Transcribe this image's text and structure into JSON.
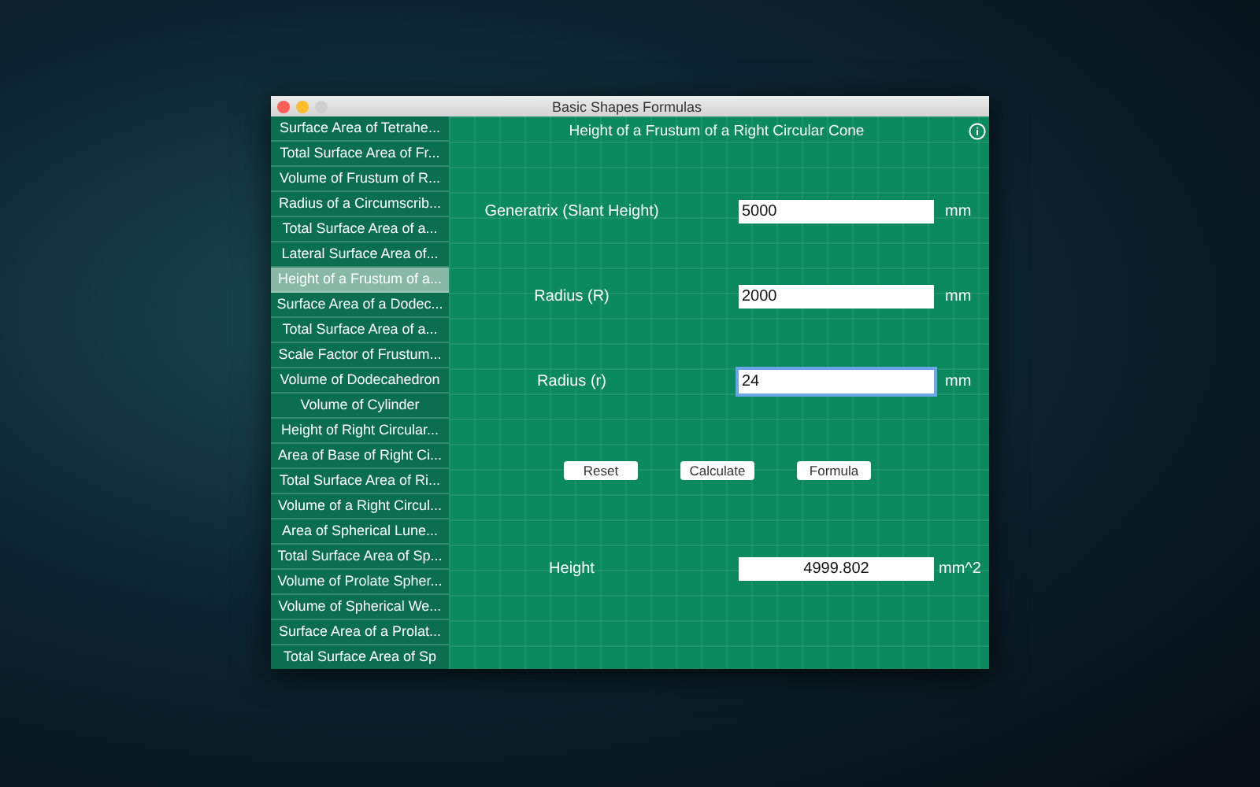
{
  "window": {
    "title": "Basic Shapes Formulas"
  },
  "sidebar": {
    "items": [
      {
        "label": "Surface Area of Tetrahe...",
        "selected": false
      },
      {
        "label": "Total Surface Area of Fr...",
        "selected": false
      },
      {
        "label": "Volume of Frustum of R...",
        "selected": false
      },
      {
        "label": "Radius of a Circumscrib...",
        "selected": false
      },
      {
        "label": "Total Surface Area of a...",
        "selected": false
      },
      {
        "label": "Lateral Surface Area of...",
        "selected": false
      },
      {
        "label": "Height of a Frustum of a...",
        "selected": true
      },
      {
        "label": "Surface Area of a Dodec...",
        "selected": false
      },
      {
        "label": "Total Surface Area of a...",
        "selected": false
      },
      {
        "label": "Scale Factor of Frustum...",
        "selected": false
      },
      {
        "label": "Volume of Dodecahedron",
        "selected": false
      },
      {
        "label": "Volume of Cylinder",
        "selected": false
      },
      {
        "label": "Height of Right Circular...",
        "selected": false
      },
      {
        "label": "Area of Base of Right Ci...",
        "selected": false
      },
      {
        "label": "Total Surface Area of Ri...",
        "selected": false
      },
      {
        "label": "Volume of a Right Circul...",
        "selected": false
      },
      {
        "label": "Area of Spherical Lune...",
        "selected": false
      },
      {
        "label": "Total Surface Area of Sp...",
        "selected": false
      },
      {
        "label": "Volume of Prolate Spher...",
        "selected": false
      },
      {
        "label": "Volume of Spherical We...",
        "selected": false
      },
      {
        "label": "Surface Area of a Prolat...",
        "selected": false
      },
      {
        "label": "Total Surface Area of Sp",
        "selected": false
      }
    ]
  },
  "main": {
    "heading": "Height of a Frustum of a Right Circular Cone",
    "inputs": [
      {
        "label": "Generatrix (Slant Height)",
        "value": "5000",
        "unit": "mm",
        "focused": false
      },
      {
        "label": "Radius (R)",
        "value": "2000",
        "unit": "mm",
        "focused": false
      },
      {
        "label": "Radius (r)",
        "value": "24",
        "unit": "mm",
        "focused": true
      }
    ],
    "buttons": [
      "Reset",
      "Calculate",
      "Formula"
    ],
    "result": {
      "label": "Height",
      "value": "4999.802",
      "unit": "mm^2"
    }
  }
}
